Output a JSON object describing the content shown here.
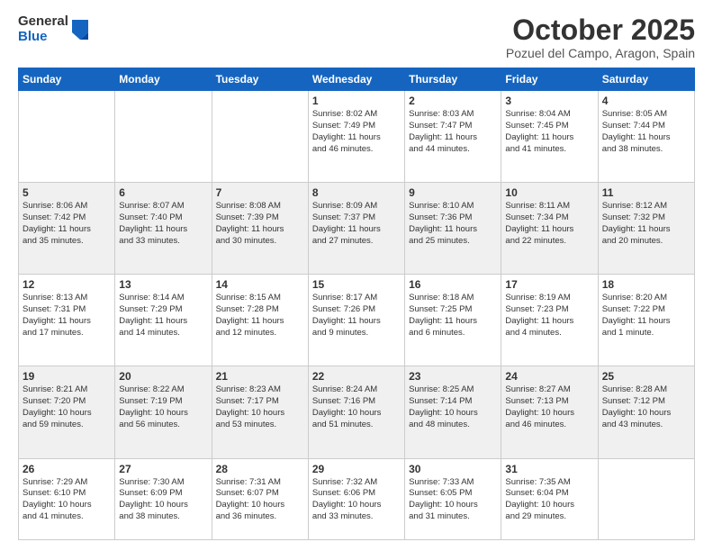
{
  "header": {
    "logo_general": "General",
    "logo_blue": "Blue",
    "month": "October 2025",
    "location": "Pozuel del Campo, Aragon, Spain"
  },
  "weekdays": [
    "Sunday",
    "Monday",
    "Tuesday",
    "Wednesday",
    "Thursday",
    "Friday",
    "Saturday"
  ],
  "weeks": [
    [
      {
        "day": "",
        "info": ""
      },
      {
        "day": "",
        "info": ""
      },
      {
        "day": "",
        "info": ""
      },
      {
        "day": "1",
        "info": "Sunrise: 8:02 AM\nSunset: 7:49 PM\nDaylight: 11 hours\nand 46 minutes."
      },
      {
        "day": "2",
        "info": "Sunrise: 8:03 AM\nSunset: 7:47 PM\nDaylight: 11 hours\nand 44 minutes."
      },
      {
        "day": "3",
        "info": "Sunrise: 8:04 AM\nSunset: 7:45 PM\nDaylight: 11 hours\nand 41 minutes."
      },
      {
        "day": "4",
        "info": "Sunrise: 8:05 AM\nSunset: 7:44 PM\nDaylight: 11 hours\nand 38 minutes."
      }
    ],
    [
      {
        "day": "5",
        "info": "Sunrise: 8:06 AM\nSunset: 7:42 PM\nDaylight: 11 hours\nand 35 minutes."
      },
      {
        "day": "6",
        "info": "Sunrise: 8:07 AM\nSunset: 7:40 PM\nDaylight: 11 hours\nand 33 minutes."
      },
      {
        "day": "7",
        "info": "Sunrise: 8:08 AM\nSunset: 7:39 PM\nDaylight: 11 hours\nand 30 minutes."
      },
      {
        "day": "8",
        "info": "Sunrise: 8:09 AM\nSunset: 7:37 PM\nDaylight: 11 hours\nand 27 minutes."
      },
      {
        "day": "9",
        "info": "Sunrise: 8:10 AM\nSunset: 7:36 PM\nDaylight: 11 hours\nand 25 minutes."
      },
      {
        "day": "10",
        "info": "Sunrise: 8:11 AM\nSunset: 7:34 PM\nDaylight: 11 hours\nand 22 minutes."
      },
      {
        "day": "11",
        "info": "Sunrise: 8:12 AM\nSunset: 7:32 PM\nDaylight: 11 hours\nand 20 minutes."
      }
    ],
    [
      {
        "day": "12",
        "info": "Sunrise: 8:13 AM\nSunset: 7:31 PM\nDaylight: 11 hours\nand 17 minutes."
      },
      {
        "day": "13",
        "info": "Sunrise: 8:14 AM\nSunset: 7:29 PM\nDaylight: 11 hours\nand 14 minutes."
      },
      {
        "day": "14",
        "info": "Sunrise: 8:15 AM\nSunset: 7:28 PM\nDaylight: 11 hours\nand 12 minutes."
      },
      {
        "day": "15",
        "info": "Sunrise: 8:17 AM\nSunset: 7:26 PM\nDaylight: 11 hours\nand 9 minutes."
      },
      {
        "day": "16",
        "info": "Sunrise: 8:18 AM\nSunset: 7:25 PM\nDaylight: 11 hours\nand 6 minutes."
      },
      {
        "day": "17",
        "info": "Sunrise: 8:19 AM\nSunset: 7:23 PM\nDaylight: 11 hours\nand 4 minutes."
      },
      {
        "day": "18",
        "info": "Sunrise: 8:20 AM\nSunset: 7:22 PM\nDaylight: 11 hours\nand 1 minute."
      }
    ],
    [
      {
        "day": "19",
        "info": "Sunrise: 8:21 AM\nSunset: 7:20 PM\nDaylight: 10 hours\nand 59 minutes."
      },
      {
        "day": "20",
        "info": "Sunrise: 8:22 AM\nSunset: 7:19 PM\nDaylight: 10 hours\nand 56 minutes."
      },
      {
        "day": "21",
        "info": "Sunrise: 8:23 AM\nSunset: 7:17 PM\nDaylight: 10 hours\nand 53 minutes."
      },
      {
        "day": "22",
        "info": "Sunrise: 8:24 AM\nSunset: 7:16 PM\nDaylight: 10 hours\nand 51 minutes."
      },
      {
        "day": "23",
        "info": "Sunrise: 8:25 AM\nSunset: 7:14 PM\nDaylight: 10 hours\nand 48 minutes."
      },
      {
        "day": "24",
        "info": "Sunrise: 8:27 AM\nSunset: 7:13 PM\nDaylight: 10 hours\nand 46 minutes."
      },
      {
        "day": "25",
        "info": "Sunrise: 8:28 AM\nSunset: 7:12 PM\nDaylight: 10 hours\nand 43 minutes."
      }
    ],
    [
      {
        "day": "26",
        "info": "Sunrise: 7:29 AM\nSunset: 6:10 PM\nDaylight: 10 hours\nand 41 minutes."
      },
      {
        "day": "27",
        "info": "Sunrise: 7:30 AM\nSunset: 6:09 PM\nDaylight: 10 hours\nand 38 minutes."
      },
      {
        "day": "28",
        "info": "Sunrise: 7:31 AM\nSunset: 6:07 PM\nDaylight: 10 hours\nand 36 minutes."
      },
      {
        "day": "29",
        "info": "Sunrise: 7:32 AM\nSunset: 6:06 PM\nDaylight: 10 hours\nand 33 minutes."
      },
      {
        "day": "30",
        "info": "Sunrise: 7:33 AM\nSunset: 6:05 PM\nDaylight: 10 hours\nand 31 minutes."
      },
      {
        "day": "31",
        "info": "Sunrise: 7:35 AM\nSunset: 6:04 PM\nDaylight: 10 hours\nand 29 minutes."
      },
      {
        "day": "",
        "info": ""
      }
    ]
  ]
}
